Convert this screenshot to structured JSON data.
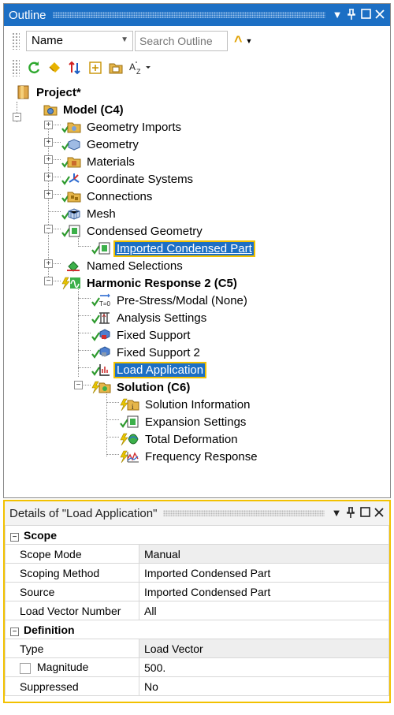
{
  "outline": {
    "title": "Outline",
    "filter_combo_value": "Name",
    "search_placeholder": "Search Outline",
    "tree": {
      "project": "Project*",
      "model": "Model (C4)",
      "geometry_imports": "Geometry Imports",
      "geometry": "Geometry",
      "materials": "Materials",
      "coordinate_systems": "Coordinate Systems",
      "connections": "Connections",
      "mesh": "Mesh",
      "condensed_geometry": "Condensed Geometry",
      "imported_condensed_part": "Imported Condensed Part",
      "named_selections": "Named Selections",
      "harmonic_response": "Harmonic Response 2 (C5)",
      "pre_stress": "Pre-Stress/Modal (None)",
      "analysis_settings": "Analysis Settings",
      "fixed_support": "Fixed Support",
      "fixed_support_2": "Fixed Support 2",
      "load_application": "Load Application",
      "solution": "Solution (C6)",
      "solution_information": "Solution Information",
      "expansion_settings": "Expansion Settings",
      "total_deformation": "Total Deformation",
      "frequency_response": "Frequency Response"
    }
  },
  "details": {
    "title": "Details of \"Load Application\"",
    "scope": {
      "header": "Scope",
      "rows": [
        {
          "key": "Scope Mode",
          "value": "Manual"
        },
        {
          "key": "Scoping Method",
          "value": "Imported Condensed Part"
        },
        {
          "key": "Source",
          "value": "Imported Condensed Part"
        },
        {
          "key": "Load Vector Number",
          "value": "All"
        }
      ]
    },
    "definition": {
      "header": "Definition",
      "rows": [
        {
          "key": "Type",
          "value": "Load Vector"
        },
        {
          "key": "Magnitude",
          "value": "500."
        },
        {
          "key": "Suppressed",
          "value": "No"
        }
      ]
    }
  },
  "colors": {
    "title_bar": "#1c6fc4",
    "selection": "#1c6fc4",
    "focus_outline": "#f2c100",
    "check_green": "#2e9a2e",
    "lightning_yellow": "#e8c400"
  }
}
